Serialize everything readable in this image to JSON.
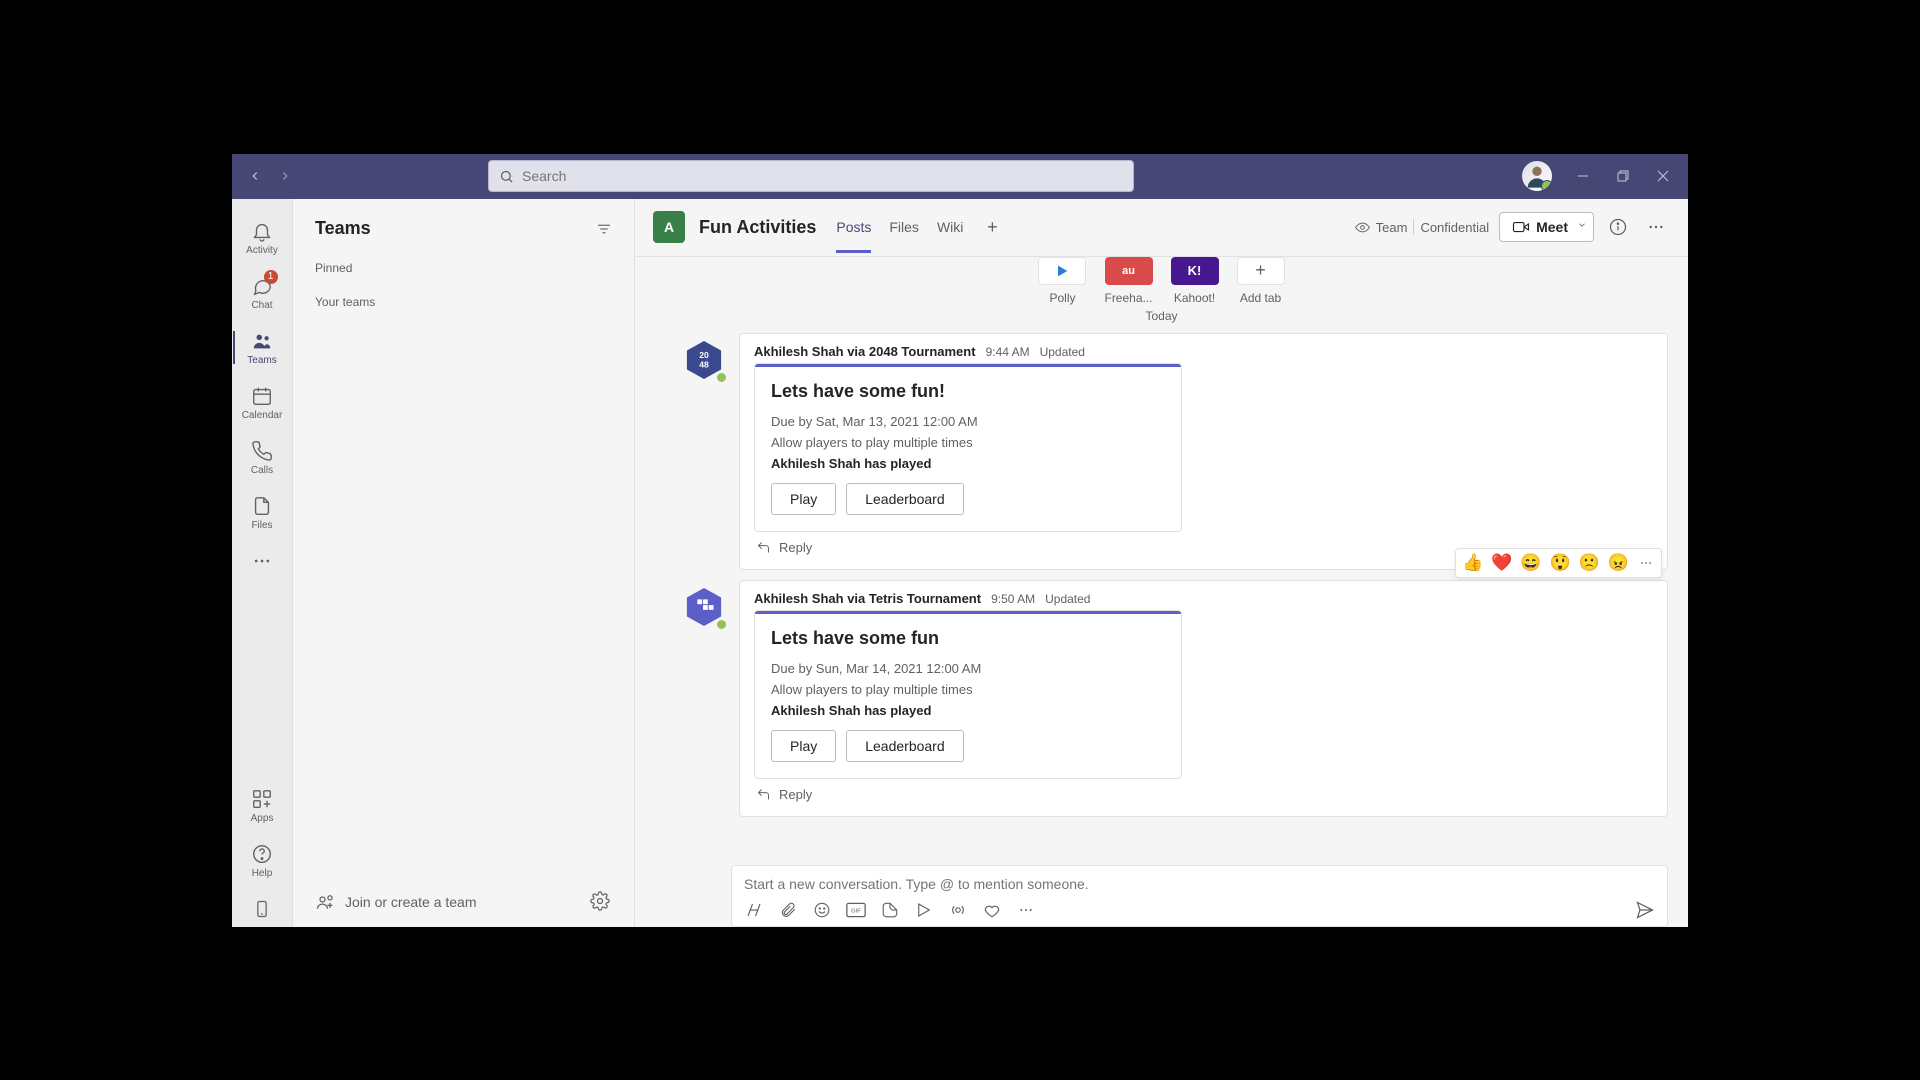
{
  "search": {
    "placeholder": "Search"
  },
  "apprail": {
    "activity": "Activity",
    "chat": "Chat",
    "chat_badge": "1",
    "teams": "Teams",
    "calendar": "Calendar",
    "calls": "Calls",
    "files": "Files",
    "apps": "Apps",
    "help": "Help"
  },
  "teams_panel": {
    "title": "Teams",
    "pinned": "Pinned",
    "your_teams": "Your teams",
    "join_create": "Join or create a team"
  },
  "channel": {
    "avatar_letter": "A",
    "name": "Fun Activities",
    "tabs": {
      "posts": "Posts",
      "files": "Files",
      "wiki": "Wiki"
    },
    "sensitivity_team": "Team",
    "sensitivity_level": "Confidential",
    "meet": "Meet"
  },
  "app_tiles": {
    "polly": "Polly",
    "freehand": "Freeha...",
    "kahoot": "Kahoot!",
    "addtab": "Add tab"
  },
  "date_divider": "Today",
  "posts": {
    "p1": {
      "author": "Akhilesh Shah via 2048 Tournament",
      "time": "9:44 AM",
      "status": "Updated",
      "card_title": "Lets have some fun!",
      "due": "Due by Sat, Mar 13, 2021 12:00 AM",
      "allow": "Allow players to play multiple times",
      "played": "Akhilesh Shah has played",
      "play_btn": "Play",
      "lb_btn": "Leaderboard",
      "reply": "Reply"
    },
    "p2": {
      "author": "Akhilesh Shah via Tetris Tournament",
      "time": "9:50 AM",
      "status": "Updated",
      "card_title": "Lets have some fun",
      "due": "Due by Sun, Mar 14, 2021 12:00 AM",
      "allow": "Allow players to play multiple times",
      "played": "Akhilesh Shah has played",
      "play_btn": "Play",
      "lb_btn": "Leaderboard",
      "reply": "Reply"
    }
  },
  "reactions": {
    "like": "👍",
    "heart": "❤️",
    "laugh": "😄",
    "surprised": "😲",
    "sad": "🙁",
    "angry": "😠"
  },
  "compose": {
    "placeholder": "Start a new conversation. Type @ to mention someone."
  }
}
